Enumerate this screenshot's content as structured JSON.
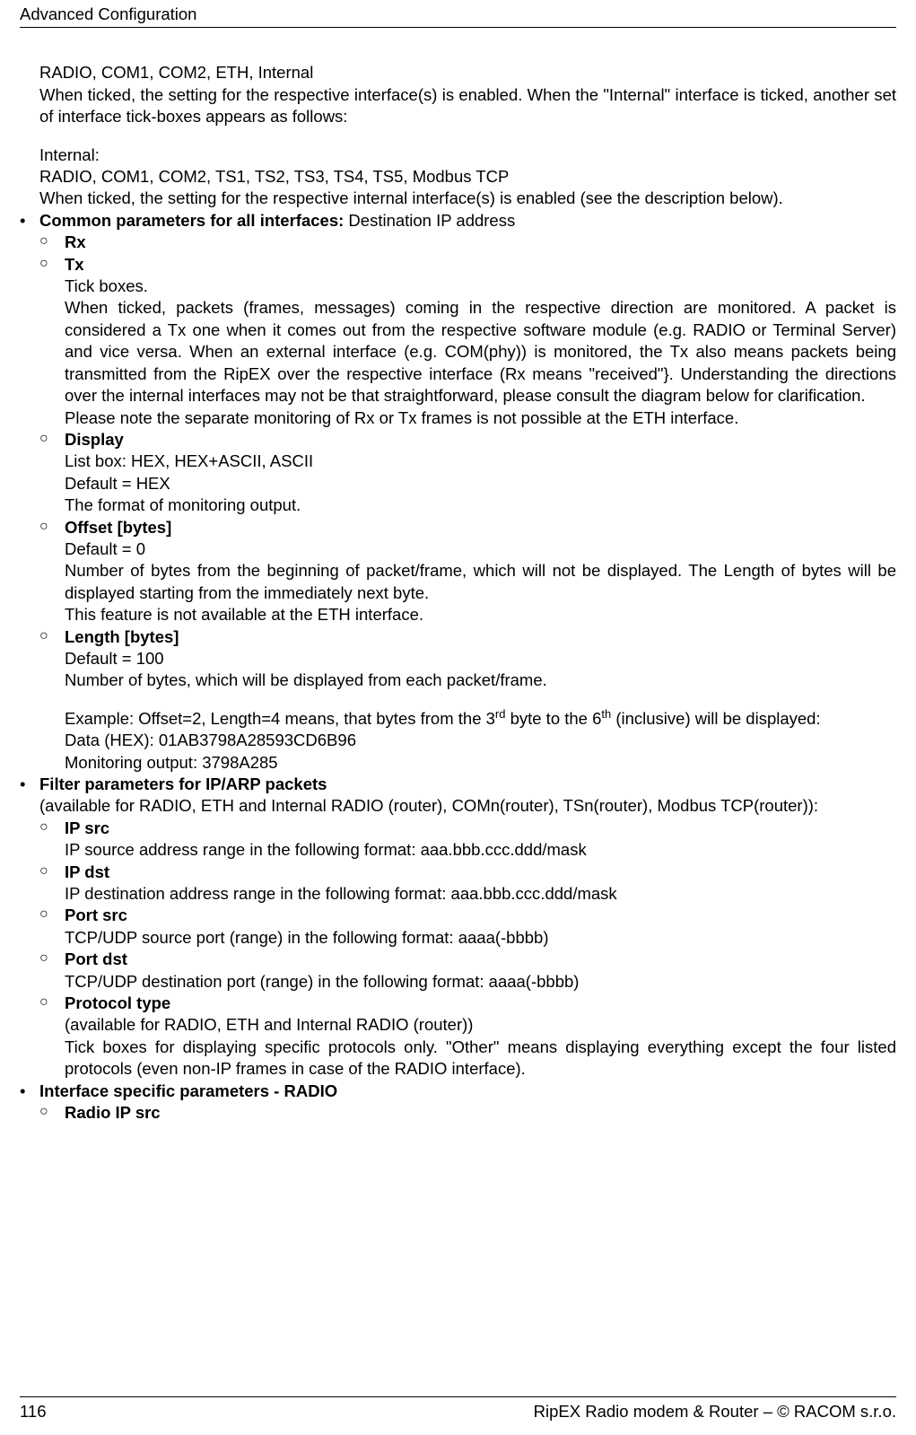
{
  "header": {
    "title": "Advanced Configuration"
  },
  "intro": {
    "line1": "RADIO, COM1, COM2, ETH, Internal",
    "line2": "When ticked, the setting for the respective interface(s) is enabled. When the \"Internal\" interface is ticked, another set of interface tick-boxes appears as follows:",
    "line3": "Internal:",
    "line4": "RADIO, COM1, COM2, TS1, TS2, TS3, TS4, TS5, Modbus TCP",
    "line5": "When ticked, the setting for the respective internal interface(s) is enabled (see the description below)."
  },
  "b1": {
    "heading_bold": "Common parameters for all interfaces:",
    "heading_rest": " Destination IP address",
    "rx": "Rx",
    "tx": "Tx",
    "tx_l1": "Tick boxes.",
    "tx_l2": "When ticked, packets (frames, messages) coming in the respective direction are monitored. A packet is considered a Tx one when it comes out from the respective software module (e.g. RADIO or Terminal Server) and vice versa. When an external interface (e.g. COM(phy)) is monitored, the Tx also means packets being transmitted from the RipEX over the respective interface (Rx means \"received\"}. Understanding the directions over the internal interfaces may not be that straightforward, please consult the diagram below for clarification.",
    "tx_l3": "Please note the separate monitoring of Rx or Tx frames is not possible at the ETH interface.",
    "display_h": "Display",
    "display_l1": "List box: HEX, HEX+ASCII, ASCII",
    "display_l2": "Default = HEX",
    "display_l3": "The format of monitoring output.",
    "offset_h": "Offset [bytes]",
    "offset_l1": "Default = 0",
    "offset_l2": "Number of bytes from the beginning of packet/frame, which will not be displayed. The Length of bytes will be displayed starting from the immediately next byte.",
    "offset_l3": "This feature is not available at the ETH interface.",
    "length_h": "Length [bytes]",
    "length_l1": "Default = 100",
    "length_l2": "Number of bytes, which will be displayed from each packet/frame.",
    "length_ex_pre": "Example: Offset=2, Length=4 means, that bytes from the 3",
    "length_ex_sup1": "rd",
    "length_ex_mid": " byte to the 6",
    "length_ex_sup2": "th",
    "length_ex_post": " (inclusive) will be displayed:",
    "length_l4": "Data (HEX): 01AB3798A28593CD6B96",
    "length_l5": "Monitoring output: 3798A285"
  },
  "b2": {
    "heading": "Filter parameters for IP/ARP packets",
    "sub": "(available for RADIO, ETH and Internal RADIO (router), COMn(router), TSn(router), Modbus TCP(router)):",
    "ipsrc_h": "IP src",
    "ipsrc_l": "IP source address range in the following format: aaa.bbb.ccc.ddd/mask",
    "ipdst_h": "IP dst",
    "ipdst_l": "IP destination address range in the following format: aaa.bbb.ccc.ddd/mask",
    "psrc_h": "Port src",
    "psrc_l": "TCP/UDP source port (range) in the following format: aaaa(-bbbb)",
    "pdst_h": "Port dst",
    "pdst_l": "TCP/UDP destination port (range) in the following format: aaaa(-bbbb)",
    "proto_h": "Protocol type",
    "proto_l1": "(available for RADIO, ETH and Internal RADIO (router))",
    "proto_l2": "Tick boxes for displaying specific protocols only. \"Other\" means displaying everything except the four listed protocols (even non-IP frames in case of the RADIO interface)."
  },
  "b3": {
    "heading": "Interface specific parameters - RADIO",
    "rip_h": "Radio IP src"
  },
  "footer": {
    "page": "116",
    "right": "RipEX Radio modem & Router – © RACOM s.r.o."
  }
}
